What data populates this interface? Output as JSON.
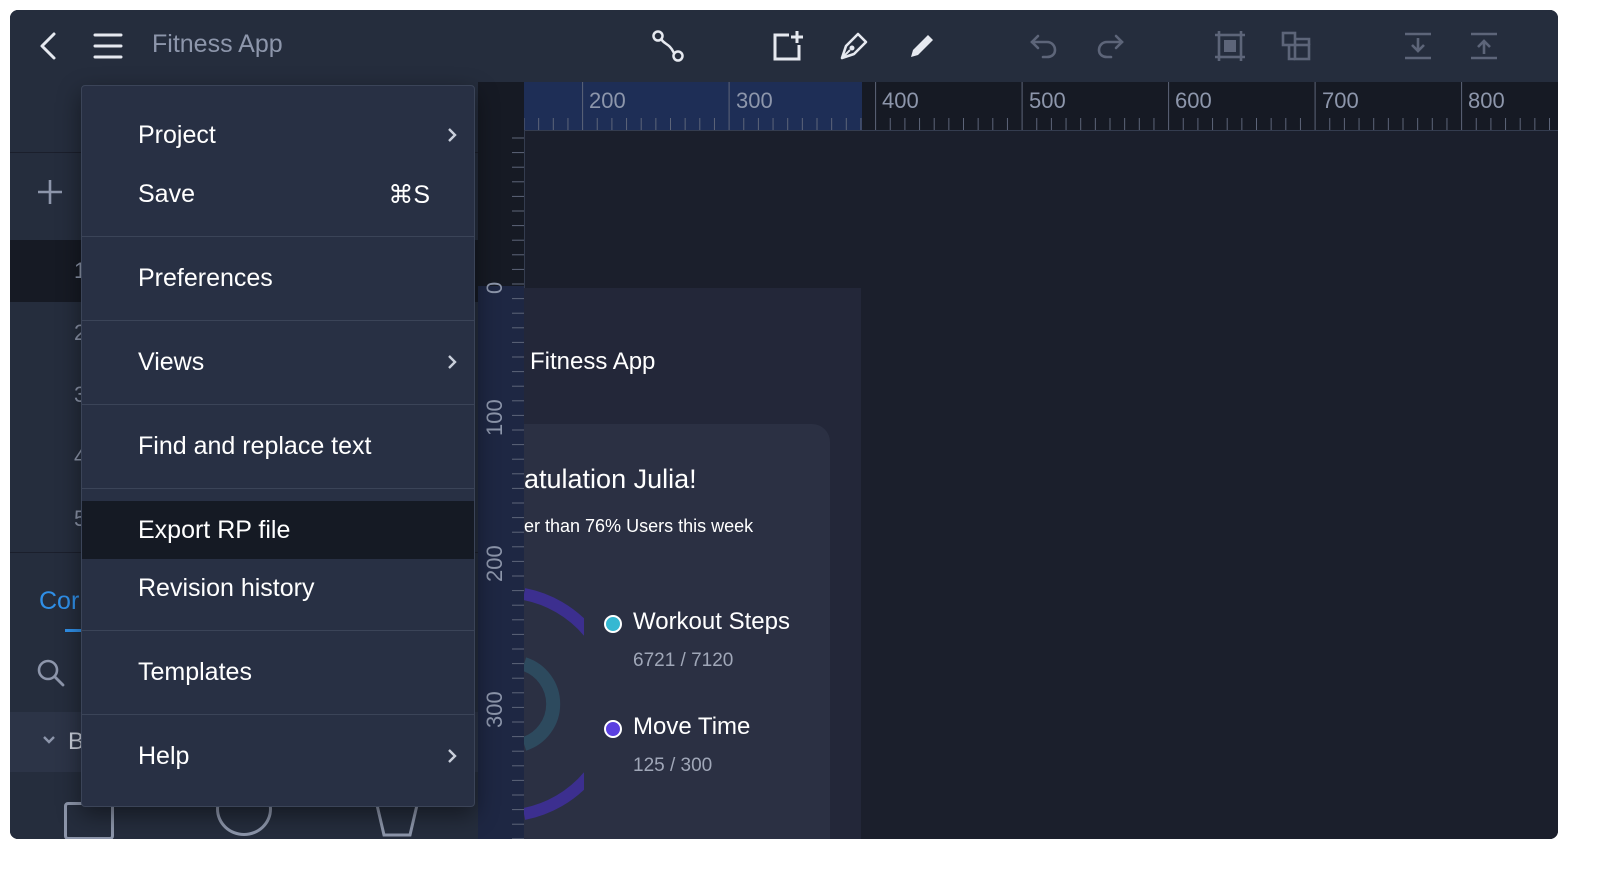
{
  "app": {
    "title": "Fitness App"
  },
  "menu": {
    "items": [
      {
        "label": "Project",
        "submenu": true
      },
      {
        "label": "Save",
        "shortcut": "⌘S"
      },
      {
        "label": "Preferences"
      },
      {
        "label": "Views",
        "submenu": true
      },
      {
        "label": "Find and replace text"
      },
      {
        "label": "Export RP file",
        "highlighted": true
      },
      {
        "label": "Revision history"
      },
      {
        "label": "Templates"
      },
      {
        "label": "Help",
        "submenu": true
      }
    ]
  },
  "sidebar": {
    "page_numbers": [
      "1",
      "2",
      "3",
      "4",
      "5"
    ],
    "components_tab_label": "Cor",
    "group_label": "B"
  },
  "rulers": {
    "horizontal": [
      "200",
      "300",
      "400",
      "500",
      "600",
      "700",
      "800"
    ],
    "vertical": [
      "0",
      "100",
      "200",
      "300",
      "0"
    ]
  },
  "artboard": {
    "header": "Fitness App",
    "card_title": "atulation Julia!",
    "card_subtitle": "er than 76% Users this week",
    "legend": [
      {
        "name": "Workout Steps",
        "value": "6721 / 7120",
        "color": "#35b8d2"
      },
      {
        "name": "Move Time",
        "value": "125 / 300",
        "color": "#5a3fe0"
      }
    ]
  },
  "colors": {
    "accent": "#2f8fe8",
    "toolbar_bg": "#252d3d",
    "canvas_bg": "#1b1f2c",
    "menu_highlight": "#151a24"
  }
}
